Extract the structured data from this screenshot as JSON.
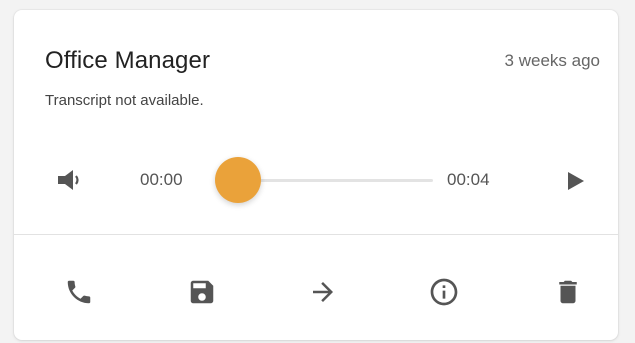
{
  "voicemail": {
    "caller": "Office Manager",
    "received": "3 weeks ago",
    "transcript": "Transcript not available."
  },
  "player": {
    "current_time": "00:00",
    "total_time": "00:04",
    "progress": 0.0,
    "volume_icon": "volume-icon",
    "play_icon": "play-icon"
  },
  "actions": {
    "items": [
      {
        "icon": "phone-icon"
      },
      {
        "icon": "save-icon"
      },
      {
        "icon": "forward-arrow-icon"
      },
      {
        "icon": "info-icon"
      },
      {
        "icon": "trash-icon"
      }
    ]
  },
  "colors": {
    "accent": "#eaa23a",
    "icon": "#555555",
    "title": "#222222",
    "muted": "#666666"
  }
}
